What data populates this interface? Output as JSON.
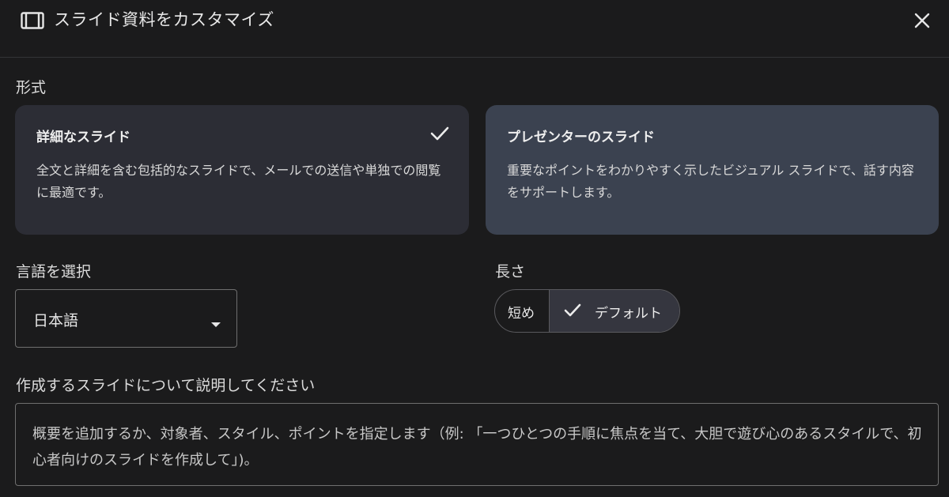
{
  "dialog": {
    "title": "スライド資料をカスタマイズ",
    "icon": "slides-icon",
    "close_icon": "close-icon"
  },
  "format": {
    "label": "形式",
    "options": [
      {
        "title": "詳細なスライド",
        "description": "全文と詳細を含む包括的なスライドで、メールでの送信や単独での閲覧に最適です。",
        "selected": true
      },
      {
        "title": "プレゼンターのスライド",
        "description": "重要なポイントをわかりやすく示したビジュアル スライドで、話す内容をサポートします。",
        "selected": false
      }
    ]
  },
  "language": {
    "label": "言語を選択",
    "value": "日本語"
  },
  "length": {
    "label": "長さ",
    "options": [
      "短め",
      "デフォルト"
    ],
    "selected": "デフォルト"
  },
  "description": {
    "label": "作成するスライドについて説明してください",
    "placeholder": "概要を追加するか、対象者、スタイル、ポイントを指定します（例: 「一つひとつの手順に焦点を当て、大胆で遊び心のあるスタイルで、初心者向けのスライドを作成して」)。"
  },
  "colors": {
    "background": "#1b1b1c",
    "card_selected": "#2c2d35",
    "card_other": "#3b4250",
    "border": "#6f6f6f"
  }
}
